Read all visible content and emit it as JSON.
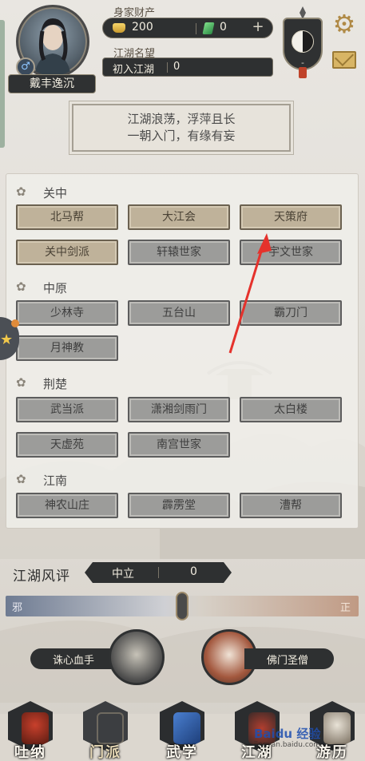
{
  "player": {
    "name": "戴丰逸沉",
    "gender_symbol": "♂",
    "wealth_label": "身家财产",
    "gold": "200",
    "jade": "0",
    "reputation_label": "江湖名望",
    "reputation_title": "初入江湖",
    "reputation_value": "0",
    "taiji_value": "-"
  },
  "motto": {
    "line1": "江湖浪荡，浮萍且长",
    "line2": "一朝入门，有缘有妄"
  },
  "regions": [
    {
      "name": "关中",
      "sects": [
        "北马帮",
        "大江会",
        "天策府",
        "关中剑派",
        "轩辕世家",
        "宇文世家"
      ]
    },
    {
      "name": "中原",
      "sects": [
        "少林寺",
        "五台山",
        "霸刀门",
        "月神教"
      ]
    },
    {
      "name": "荆楚",
      "sects": [
        "武当派",
        "潇湘剑雨门",
        "太白楼",
        "天虚苑",
        "南宫世家"
      ]
    },
    {
      "name": "江南",
      "sects": [
        "神农山庄",
        "霹雳堂",
        "漕帮"
      ]
    }
  ],
  "fengping": {
    "title": "江湖风评",
    "status": "中立",
    "value": "0",
    "left_label": "邪",
    "right_label": "正",
    "level": 0.5
  },
  "duel": {
    "left": "诛心血手",
    "right": "佛门圣僧"
  },
  "nav": {
    "items": [
      "吐纳",
      "门派",
      "武学",
      "江湖",
      "游历"
    ],
    "active": "门派"
  },
  "watermark": "Baidu 经验",
  "watermark_url": "jingyan.baidu.com",
  "colors": {
    "annotation_arrow": "#e5322c",
    "panel_tan": "#bfb29a",
    "panel_gray": "#9c9c9a"
  }
}
